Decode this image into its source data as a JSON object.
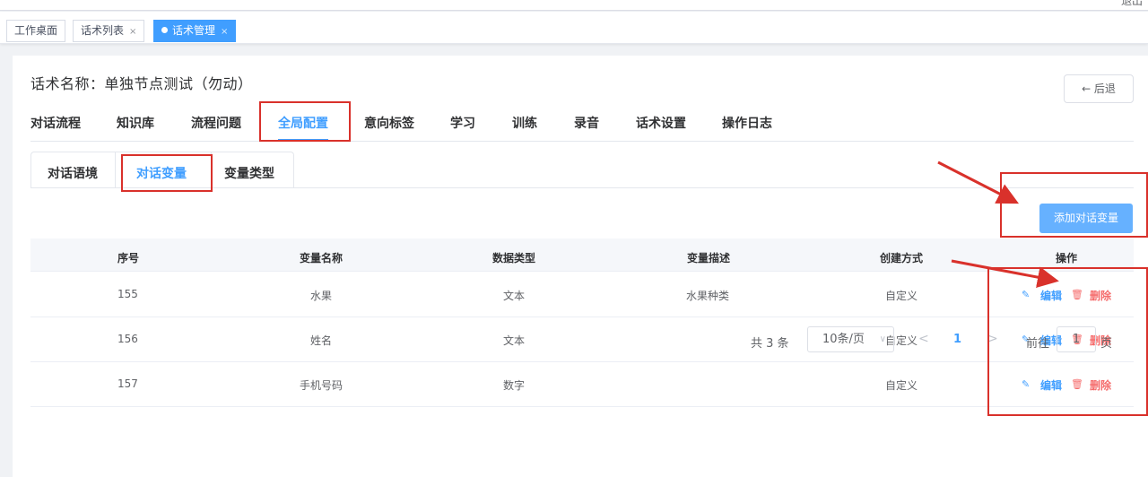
{
  "top_corner_text": "退出",
  "tags": [
    {
      "label": "工作桌面",
      "closable": false,
      "active": false
    },
    {
      "label": "话术列表",
      "closable": true,
      "active": false
    },
    {
      "label": "话术管理",
      "closable": true,
      "active": true
    }
  ],
  "close_symbol": "×",
  "script_name": "话术名称：单独节点测试（勿动）",
  "back_button": "← 后退",
  "main_tabs": [
    {
      "label": "对话流程"
    },
    {
      "label": "知识库"
    },
    {
      "label": "流程问题"
    },
    {
      "label": "全局配置",
      "active": true
    },
    {
      "label": "意向标签"
    },
    {
      "label": "学习"
    },
    {
      "label": "训练"
    },
    {
      "label": "录音"
    },
    {
      "label": "话术设置"
    },
    {
      "label": "操作日志"
    }
  ],
  "sub_tabs": [
    {
      "label": "对话语境"
    },
    {
      "label": "对话变量",
      "active": true
    },
    {
      "label": "变量类型"
    }
  ],
  "add_button": "添加对话变量",
  "table": {
    "columns": [
      "序号",
      "变量名称",
      "数据类型",
      "变量描述",
      "创建方式",
      "操作"
    ],
    "rows": [
      {
        "id": "155",
        "name": "水果",
        "type": "文本",
        "desc": "水果种类",
        "method": "自定义"
      },
      {
        "id": "156",
        "name": "姓名",
        "type": "文本",
        "desc": "",
        "method": "自定义"
      },
      {
        "id": "157",
        "name": "手机号码",
        "type": "数字",
        "desc": "",
        "method": "自定义"
      }
    ],
    "edit_label": "编辑",
    "delete_label": "删除"
  },
  "pagination": {
    "total": "共 3 条",
    "page_size": "10条/页",
    "prev": "<",
    "next": ">",
    "current_page": "1",
    "goto_label": "前往",
    "goto_value": "1",
    "page_unit": "页"
  },
  "colors": {
    "accent": "#409eff",
    "danger": "#f56c6c",
    "annotation": "#d9312b"
  }
}
